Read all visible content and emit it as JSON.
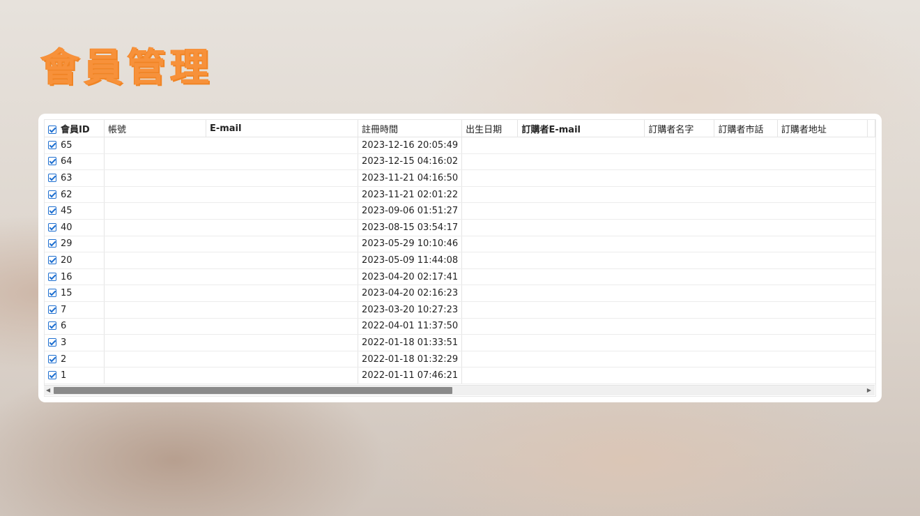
{
  "title": "會員管理",
  "table": {
    "headers": {
      "member_id": "會員ID",
      "account": "帳號",
      "email": "E-mail",
      "register_time": "註冊時間",
      "birthday": "出生日期",
      "buyer_email": "訂購者E-mail",
      "buyer_name": "訂購者名字",
      "buyer_phone": "訂購者市話",
      "buyer_address": "訂購者地址"
    },
    "rows": [
      {
        "id": "65",
        "register_time": "2023-12-16 20:05:49"
      },
      {
        "id": "64",
        "register_time": "2023-12-15 04:16:02"
      },
      {
        "id": "63",
        "register_time": "2023-11-21 04:16:50"
      },
      {
        "id": "62",
        "register_time": "2023-11-21 02:01:22"
      },
      {
        "id": "45",
        "register_time": "2023-09-06 01:51:27"
      },
      {
        "id": "40",
        "register_time": "2023-08-15 03:54:17"
      },
      {
        "id": "29",
        "register_time": "2023-05-29 10:10:46"
      },
      {
        "id": "20",
        "register_time": "2023-05-09 11:44:08"
      },
      {
        "id": "16",
        "register_time": "2023-04-20 02:17:41"
      },
      {
        "id": "15",
        "register_time": "2023-04-20 02:16:23"
      },
      {
        "id": "7",
        "register_time": "2023-03-20 10:27:23"
      },
      {
        "id": "6",
        "register_time": "2022-04-01 11:37:50"
      },
      {
        "id": "3",
        "register_time": "2022-01-18 01:33:51"
      },
      {
        "id": "2",
        "register_time": "2022-01-18 01:32:29"
      },
      {
        "id": "1",
        "register_time": "2022-01-11 07:46:21"
      }
    ]
  },
  "colors": {
    "title": "#f7913a",
    "checkbox": "#1e6fd0"
  }
}
